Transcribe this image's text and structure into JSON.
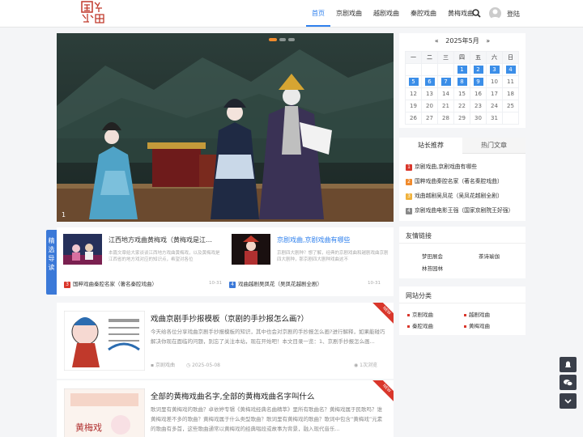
{
  "logo": {
    "text": "国戏曲"
  },
  "nav": {
    "items": [
      {
        "label": "首页",
        "active": true
      },
      {
        "label": "京剧戏曲"
      },
      {
        "label": "越剧戏曲"
      },
      {
        "label": "秦腔戏曲"
      },
      {
        "label": "黄梅戏曲"
      }
    ],
    "login": "登陆"
  },
  "hero": {
    "slide_number": "1"
  },
  "guide": {
    "label": "精选导读",
    "items": [
      {
        "title": "江西地方戏曲黄梅戏（黄梅戏是江…",
        "excerpt": "本篇文章给大家谈谈江西地方戏曲黄梅戏，以及黄梅戏是江西省的地方戏对应的知识点，希望对各位"
      },
      {
        "title": "京剧戏曲,京剧戏曲有哪些",
        "excerpt": "京剧四大剧种？想了解，经典的京剧戏曲和越剧戏曲京剧四大剧种，那京剧四大剧种戏曲这不"
      }
    ],
    "links": [
      {
        "num": "3",
        "text": "国粹戏曲秦腔名家（著名秦腔戏曲）",
        "date": "10-31"
      },
      {
        "num": "4",
        "text": "戏曲越剧吴凤花（吴凤花越剧全剧）",
        "date": "10-31"
      }
    ]
  },
  "posts": [
    {
      "title": "戏曲京剧手抄报模板（京剧的手抄报怎么画?）",
      "excerpt": "今天给各位分享戏曲京剧手抄报模板的知识，其中也会对京剧的手抄报怎么画?进行解释，如果能碰巧解决你现在面临的问题，别忘了关注本站，现在开始吧！本文目录一览：1、京剧手抄报怎么画...",
      "category": "京剧戏曲",
      "date": "2025-05-08",
      "views": "1次浏览",
      "ribbon": "NEW"
    },
    {
      "title": "全部的黄梅戏曲名字,全部的黄梅戏曲名字叫什么",
      "excerpt": "歌词里有黄梅戏的歌曲？卓依婷专辑《黄梅戏经典名曲精萃》里所有歌曲名？黄梅戏属于民歌吗？谁黄梅戏差不多的歌曲？黄梅戏属于什么类型歌曲？歌词里有黄梅戏的歌曲？歌词中包含“黄梅戏”元素的歌曲有多首，这些歌曲通常以黄梅戏的经典唱段或故事为背景，融入现代音乐...",
      "ribbon": "NEW"
    }
  ],
  "calendar": {
    "prev": "«",
    "title": "2025年5月",
    "next": "»",
    "weekdays": [
      "一",
      "二",
      "三",
      "四",
      "五",
      "六",
      "日"
    ],
    "weeks": [
      [
        "",
        "",
        "",
        "1",
        "2",
        "3",
        "4"
      ],
      [
        "5",
        "6",
        "7",
        "8",
        "9",
        "10",
        "11"
      ],
      [
        "12",
        "13",
        "14",
        "15",
        "16",
        "17",
        "18"
      ],
      [
        "19",
        "20",
        "21",
        "22",
        "23",
        "24",
        "25"
      ],
      [
        "26",
        "27",
        "28",
        "29",
        "30",
        "31",
        ""
      ]
    ],
    "linked_days": [
      "1",
      "2",
      "3",
      "4",
      "5",
      "6",
      "7",
      "8",
      "9"
    ]
  },
  "recommend": {
    "tabs": [
      "站长推荐",
      "热门文章"
    ],
    "items": [
      {
        "num": "1",
        "text": "京剧戏曲,京剧戏曲有哪些",
        "color": "#d9362b"
      },
      {
        "num": "2",
        "text": "国粹戏曲秦腔名家（著名秦腔戏曲）",
        "color": "#f08a2c"
      },
      {
        "num": "3",
        "text": "戏曲越剧吴凤花（吴凤花越剧全剧）",
        "color": "#f0b23c"
      },
      {
        "num": "4",
        "text": "京剧戏曲电影王强（国家京剧院王好强）",
        "color": "#888888"
      }
    ]
  },
  "friend_links": {
    "title": "友情链接",
    "items": [
      "梦田展会",
      "茶诗瑜伽",
      "林苔园林"
    ]
  },
  "categories": {
    "title": "网站分类",
    "items": [
      "京剧戏曲",
      "越剧戏曲",
      "秦腔戏曲",
      "黄梅戏曲"
    ]
  },
  "colors": {
    "accent": "#2f80ed",
    "guide_blue": "#3b79d8",
    "red": "#d9362b"
  }
}
